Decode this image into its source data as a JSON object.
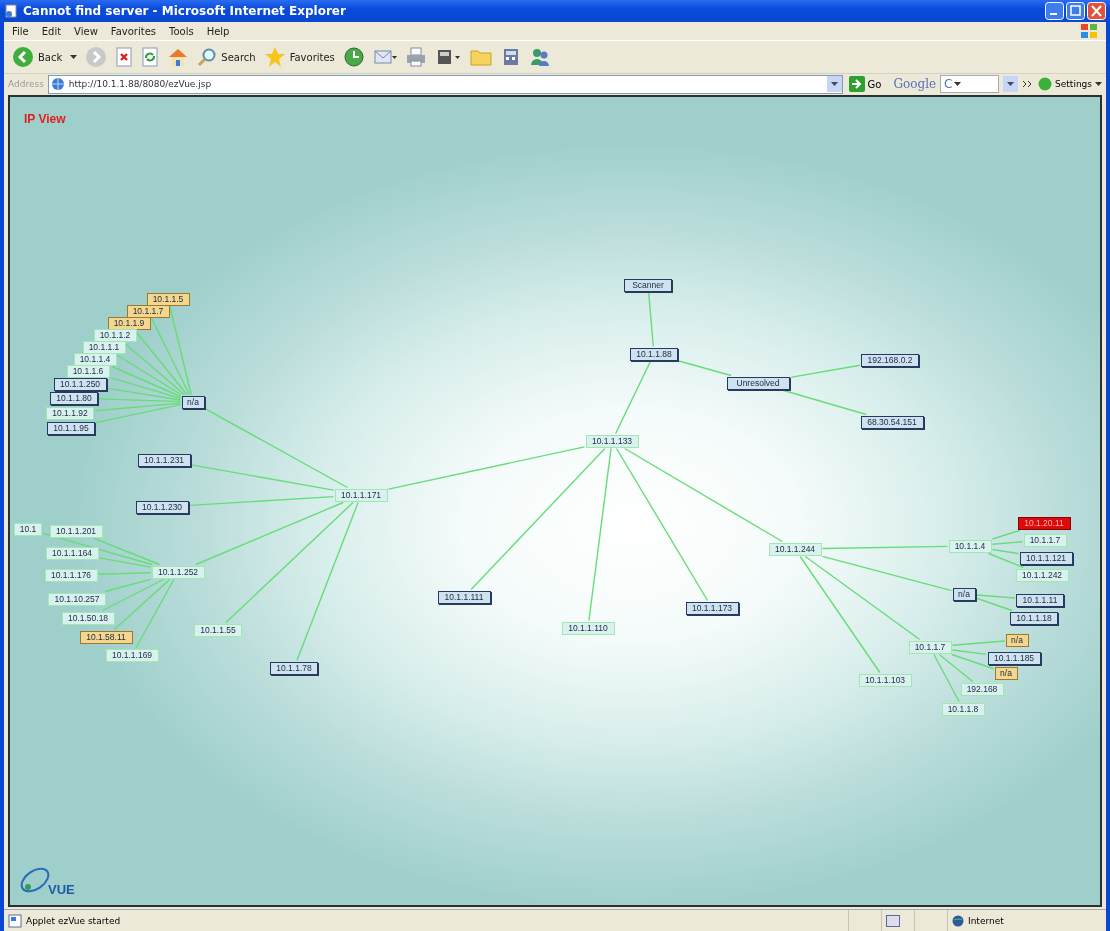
{
  "window": {
    "title": "Cannot find server - Microsoft Internet Explorer",
    "menu": [
      "File",
      "Edit",
      "View",
      "Favorites",
      "Tools",
      "Help"
    ],
    "toolbar": {
      "back": "Back",
      "search": "Search",
      "favorites": "Favorites"
    },
    "address": {
      "label": "Address",
      "url": "http://10.1.1.88/8080/ezVue.jsp",
      "go": "Go",
      "search_brand": "Google",
      "search_box": "C",
      "settings": "Settings"
    }
  },
  "view": {
    "title": "IP View",
    "logo": "VUE",
    "root": {
      "label": "10.1.1.133",
      "kind": "plain",
      "children": [
        {
          "label": "10.1.1.88",
          "kind": "boxed",
          "children": [
            {
              "label": "Scanner",
              "kind": "boxed"
            },
            {
              "label": "Unresolved",
              "kind": "boxed",
              "children": [
                {
                  "label": "192.168.0.2",
                  "kind": "boxed"
                },
                {
                  "label": "68.30.54.151",
                  "kind": "boxed"
                }
              ]
            }
          ]
        },
        {
          "label": "10.1.1.171",
          "kind": "plain",
          "children": [
            {
              "label": "n/a",
              "kind": "boxed",
              "children": [
                {
                  "label": "10.1.1.5",
                  "kind": "warning"
                },
                {
                  "label": "10.1.1.7",
                  "kind": "warning"
                },
                {
                  "label": "10.1.1.9",
                  "kind": "warning"
                },
                {
                  "label": "10.1.1.2",
                  "kind": "plain"
                },
                {
                  "label": "10.1.1.1",
                  "kind": "plain"
                },
                {
                  "label": "10.1.1.4",
                  "kind": "plain"
                },
                {
                  "label": "10.1.1.6",
                  "kind": "plain"
                },
                {
                  "label": "10.1.1.250",
                  "kind": "boxed"
                },
                {
                  "label": "10.1.1.80",
                  "kind": "boxed"
                },
                {
                  "label": "10.1.1.92",
                  "kind": "plain"
                },
                {
                  "label": "10.1.1.95",
                  "kind": "boxed"
                }
              ]
            },
            {
              "label": "10.1.1.231",
              "kind": "boxed"
            },
            {
              "label": "10.1.1.230",
              "kind": "boxed"
            },
            {
              "label": "10.1.1.252",
              "kind": "plain",
              "children": [
                {
                  "label": "10.1",
                  "kind": "plain"
                },
                {
                  "label": "10.1.1.201",
                  "kind": "plain"
                },
                {
                  "label": "10.1.1.164",
                  "kind": "plain"
                },
                {
                  "label": "10.1.1.176",
                  "kind": "plain"
                },
                {
                  "label": "10.1.10.257",
                  "kind": "plain"
                },
                {
                  "label": "10.1.50.18",
                  "kind": "plain"
                },
                {
                  "label": "10.1.58.11",
                  "kind": "warning"
                },
                {
                  "label": "10.1.1.169",
                  "kind": "plain"
                }
              ]
            },
            {
              "label": "10.1.1.55",
              "kind": "plain"
            },
            {
              "label": "10.1.1.78",
              "kind": "boxed"
            }
          ]
        },
        {
          "label": "10.1.1.111",
          "kind": "boxed"
        },
        {
          "label": "10.1.1.110",
          "kind": "plain"
        },
        {
          "label": "10.1.1.173",
          "kind": "boxed"
        },
        {
          "label": "10.1.1.244",
          "kind": "plain",
          "children": [
            {
              "label": "10.1.1.4",
              "kind": "plain",
              "children": [
                {
                  "label": "10.1.20.11",
                  "kind": "alert"
                },
                {
                  "label": "10.1.1.7",
                  "kind": "plain"
                },
                {
                  "label": "10.1.1.121",
                  "kind": "boxed"
                },
                {
                  "label": "10.1.1.242",
                  "kind": "plain"
                }
              ]
            },
            {
              "label": "n/a",
              "kind": "boxed",
              "children": [
                {
                  "label": "10.1.1.11",
                  "kind": "boxed"
                },
                {
                  "label": "10.1.1.18",
                  "kind": "boxed"
                }
              ]
            },
            {
              "label": "10.1.1.7",
              "kind": "plain",
              "children": [
                {
                  "label": "n/a",
                  "kind": "warning"
                },
                {
                  "label": "10.1.1.185",
                  "kind": "boxed"
                },
                {
                  "label": "n/a",
                  "kind": "warning"
                },
                {
                  "label": "192.168",
                  "kind": "plain"
                },
                {
                  "label": "10.1.1.8",
                  "kind": "plain"
                }
              ]
            },
            {
              "label": "10.1.1.103",
              "kind": "plain"
            }
          ]
        }
      ]
    }
  },
  "status_bar": {
    "text": "Applet ezVue started",
    "zone": "Internet"
  }
}
